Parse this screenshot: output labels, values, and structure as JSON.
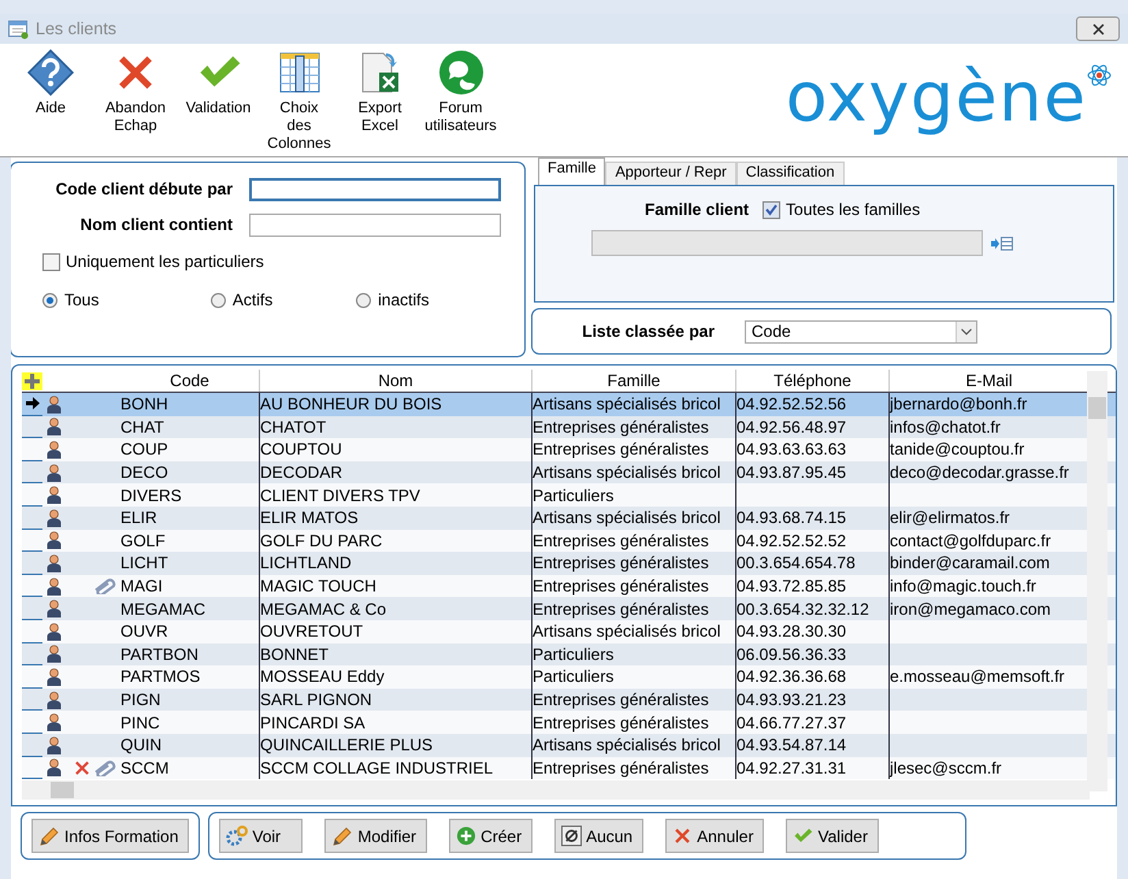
{
  "window": {
    "title": "Les clients"
  },
  "toolbar": [
    {
      "label": "Aide"
    },
    {
      "label": "Abandon\nEchap"
    },
    {
      "label": "Validation"
    },
    {
      "label": "Choix\ndes\nColonnes"
    },
    {
      "label": "Export\nExcel"
    },
    {
      "label": "Forum\nutilisateurs"
    }
  ],
  "logo": {
    "text": "oxygène"
  },
  "filters": {
    "fields": [
      {
        "label": "Code client débute par",
        "focused": true
      },
      {
        "label": "Nom client contient",
        "focused": false
      }
    ],
    "checkbox": {
      "label": "Uniquement les particuliers",
      "checked": false
    },
    "radios": [
      {
        "label": "Tous",
        "selected": true
      },
      {
        "label": "Actifs",
        "selected": false
      },
      {
        "label": "inactifs",
        "selected": false
      }
    ]
  },
  "tabs": [
    {
      "label": "Famille",
      "selected": true
    },
    {
      "label": "Apporteur / Repr",
      "selected": false
    },
    {
      "label": "Classification",
      "selected": false
    }
  ],
  "famille": {
    "label": "Famille client",
    "checkbox": {
      "label": "Toutes les familles",
      "checked": true
    },
    "field_disabled": true
  },
  "sort": {
    "label": "Liste classée par",
    "value": "Code"
  },
  "grid": {
    "columns": [
      "Code",
      "Nom",
      "Famille",
      "Téléphone",
      "E-Mail"
    ],
    "rows": [
      {
        "code": "BONH",
        "nom": "AU BONHEUR DU BOIS",
        "famille": "Artisans spécialisés bricol",
        "telephone": "04.92.52.52.56",
        "email": "jbernardo@bonh.fr",
        "selected": true,
        "attachment": false,
        "deleted": false
      },
      {
        "code": "CHAT",
        "nom": "CHATOT",
        "famille": "Entreprises généralistes",
        "telephone": "04.92.56.48.97",
        "email": "infos@chatot.fr",
        "selected": false,
        "attachment": false,
        "deleted": false
      },
      {
        "code": "COUP",
        "nom": "COUPTOU",
        "famille": "Entreprises généralistes",
        "telephone": "04.93.63.63.63",
        "email": "tanide@couptou.fr",
        "selected": false,
        "attachment": false,
        "deleted": false
      },
      {
        "code": "DECO",
        "nom": "DECODAR",
        "famille": "Artisans spécialisés bricol",
        "telephone": "04.93.87.95.45",
        "email": "deco@decodar.grasse.fr",
        "selected": false,
        "attachment": false,
        "deleted": false
      },
      {
        "code": "DIVERS",
        "nom": "CLIENT DIVERS TPV",
        "famille": "Particuliers",
        "telephone": "",
        "email": "",
        "selected": false,
        "attachment": false,
        "deleted": false
      },
      {
        "code": "ELIR",
        "nom": "ELIR MATOS",
        "famille": "Artisans spécialisés bricol",
        "telephone": "04.93.68.74.15",
        "email": "elir@elirmatos.fr",
        "selected": false,
        "attachment": false,
        "deleted": false
      },
      {
        "code": "GOLF",
        "nom": "GOLF DU PARC",
        "famille": "Entreprises généralistes",
        "telephone": "04.92.52.52.52",
        "email": "contact@golfduparc.fr",
        "selected": false,
        "attachment": false,
        "deleted": false
      },
      {
        "code": "LICHT",
        "nom": "LICHTLAND",
        "famille": "Entreprises généralistes",
        "telephone": "00.3.654.654.78",
        "email": "binder@caramail.com",
        "selected": false,
        "attachment": false,
        "deleted": false
      },
      {
        "code": "MAGI",
        "nom": "MAGIC TOUCH",
        "famille": "Entreprises généralistes",
        "telephone": "04.93.72.85.85",
        "email": "info@magic.touch.fr",
        "selected": false,
        "attachment": true,
        "deleted": false
      },
      {
        "code": "MEGAMAC",
        "nom": "MEGAMAC & Co",
        "famille": "Entreprises généralistes",
        "telephone": "00.3.654.32.32.12",
        "email": "iron@megamaco.com",
        "selected": false,
        "attachment": false,
        "deleted": false
      },
      {
        "code": "OUVR",
        "nom": "OUVRETOUT",
        "famille": "Artisans spécialisés bricol",
        "telephone": "04.93.28.30.30",
        "email": "",
        "selected": false,
        "attachment": false,
        "deleted": false
      },
      {
        "code": "PARTBON",
        "nom": "BONNET",
        "famille": "Particuliers",
        "telephone": "06.09.56.36.33",
        "email": "",
        "selected": false,
        "attachment": false,
        "deleted": false
      },
      {
        "code": "PARTMOS",
        "nom": "MOSSEAU Eddy",
        "famille": "Particuliers",
        "telephone": "04.92.36.36.68",
        "email": "e.mosseau@memsoft.fr",
        "selected": false,
        "attachment": false,
        "deleted": false
      },
      {
        "code": "PIGN",
        "nom": "SARL PIGNON",
        "famille": "Entreprises généralistes",
        "telephone": "04.93.93.21.23",
        "email": "",
        "selected": false,
        "attachment": false,
        "deleted": false
      },
      {
        "code": "PINC",
        "nom": "PINCARDI SA",
        "famille": "Entreprises généralistes",
        "telephone": "04.66.77.27.37",
        "email": "",
        "selected": false,
        "attachment": false,
        "deleted": false
      },
      {
        "code": "QUIN",
        "nom": "QUINCAILLERIE PLUS",
        "famille": "Artisans spécialisés bricol",
        "telephone": "04.93.54.87.14",
        "email": "",
        "selected": false,
        "attachment": false,
        "deleted": false
      },
      {
        "code": "SCCM",
        "nom": "SCCM COLLAGE INDUSTRIEL",
        "famille": "Entreprises généralistes",
        "telephone": "04.92.27.31.31",
        "email": "jlesec@sccm.fr",
        "selected": false,
        "attachment": true,
        "deleted": true
      }
    ]
  },
  "buttons_left": [
    {
      "label": "Infos Formation"
    }
  ],
  "buttons_right": [
    {
      "label": "Voir"
    },
    {
      "label": "Modifier"
    },
    {
      "label": "Créer"
    },
    {
      "label": "Aucun"
    },
    {
      "label": "Annuler"
    },
    {
      "label": "Valider"
    }
  ]
}
